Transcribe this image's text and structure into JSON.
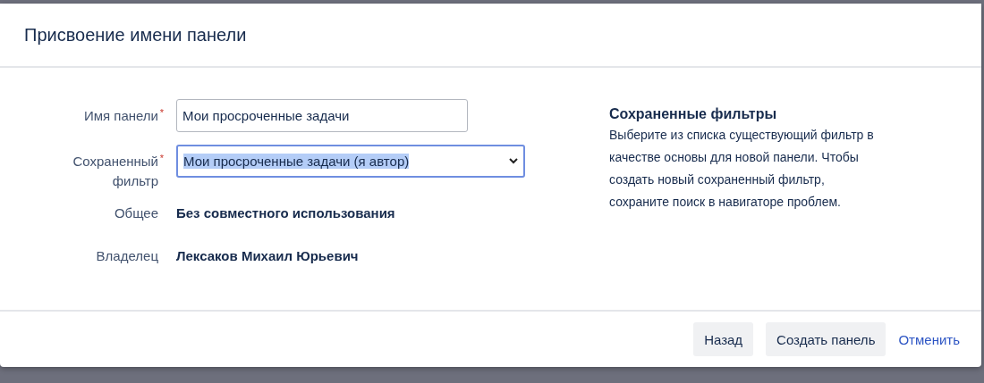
{
  "dialog": {
    "title": "Присвоение имени панели",
    "fields": [
      {
        "kind": "text",
        "label": "Имя панели",
        "required": "*",
        "value": "Мои просроченные задачи"
      },
      {
        "kind": "select",
        "label": "Сохраненный фильтр",
        "required": "*",
        "value": "Мои просроченные задачи (я автор)",
        "focused": true
      },
      {
        "kind": "static",
        "label": "Общее",
        "value": "Без совместного использования"
      },
      {
        "kind": "static",
        "label": "Владелец",
        "value": "Лексаков Михаил Юрьевич"
      }
    ],
    "help": {
      "heading": "Сохраненные фильтры",
      "text": "Выберите из списка существующий фильтр в качестве основы для новой панели. Чтобы создать новый сохраненный фильтр, сохраните поиск в навигаторе проблем."
    },
    "buttons": [
      {
        "kind": "button",
        "label": "Назад"
      },
      {
        "kind": "button",
        "label": "Создать панель"
      },
      {
        "kind": "link",
        "label": "Отменить"
      }
    ]
  }
}
